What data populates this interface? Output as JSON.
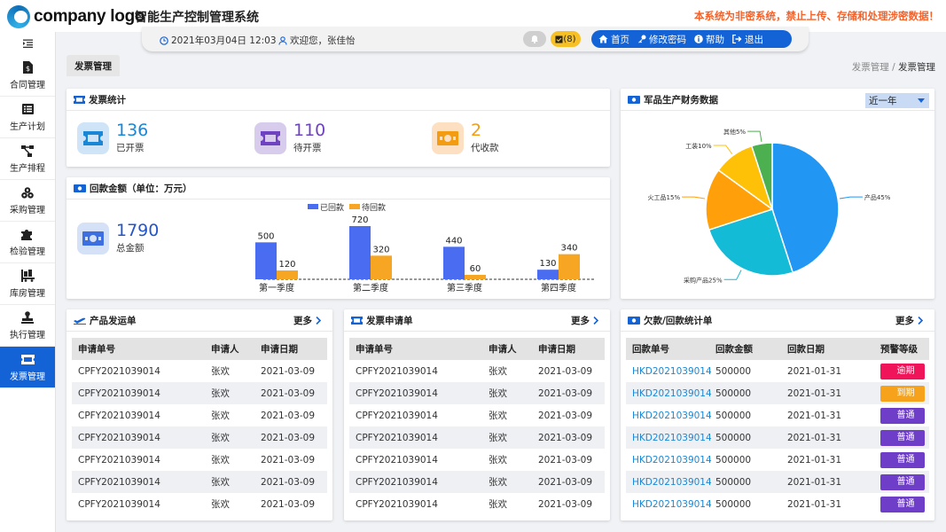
{
  "header": {
    "logo_text": "company logo",
    "system_name": "智能生产控制管理系统",
    "notice": "本系统为非密系统，禁止上传、存储和处理涉密数据！"
  },
  "infobar": {
    "datetime": "2021年03月04日 12:03",
    "welcome": "欢迎您，张佳怡",
    "task_count": "(8)",
    "nav": [
      {
        "label": "首页",
        "icon": "home-icon"
      },
      {
        "label": "修改密码",
        "icon": "key-icon"
      },
      {
        "label": "帮助",
        "icon": "info-icon"
      },
      {
        "label": "退出",
        "icon": "logout-icon"
      }
    ]
  },
  "sidebar": {
    "items": [
      {
        "label": "合同管理",
        "icon": "document-dollar-icon"
      },
      {
        "label": "生产计划",
        "icon": "list-icon"
      },
      {
        "label": "生产排程",
        "icon": "flow-icon"
      },
      {
        "label": "采购管理",
        "icon": "boxes-icon"
      },
      {
        "label": "检验管理",
        "icon": "puzzle-icon"
      },
      {
        "label": "库房管理",
        "icon": "warehouse-icon"
      },
      {
        "label": "执行管理",
        "icon": "stamp-icon"
      },
      {
        "label": "发票管理",
        "icon": "ticket-icon",
        "active": true
      }
    ]
  },
  "page": {
    "tab": "发票管理",
    "breadcrumb_parent": "发票管理",
    "breadcrumb_sep": "/",
    "breadcrumb_current": "发票管理"
  },
  "invoice_stats": {
    "title": "发票统计",
    "items": [
      {
        "value": "136",
        "label": "已开票",
        "color": "#1a87d6"
      },
      {
        "value": "110",
        "label": "待开票",
        "color": "#6f42c1"
      },
      {
        "value": "2",
        "label": "代收款",
        "color": "#f39c12"
      }
    ]
  },
  "collection": {
    "title": "回款金额（单位：万元）",
    "total_value": "1790",
    "total_label": "总金额",
    "colors": {
      "collected": "#4a6cf0",
      "pending": "#f7a623"
    }
  },
  "chart_data": [
    {
      "type": "bar",
      "title": "回款金额（单位：万元）",
      "categories": [
        "第一季度",
        "第二季度",
        "第三季度",
        "第四季度"
      ],
      "series": [
        {
          "name": "已回款",
          "values": [
            500,
            720,
            440,
            130
          ]
        },
        {
          "name": "待回款",
          "values": [
            120,
            320,
            60,
            340
          ]
        }
      ],
      "legend": "top",
      "grid": false
    },
    {
      "type": "pie",
      "title": "军品生产财务数据",
      "slices": [
        {
          "label": "产品45%",
          "value": 45,
          "color": "#2196f3"
        },
        {
          "label": "采购产品25%",
          "value": 25,
          "color": "#13bbd6"
        },
        {
          "label": "火工品15%",
          "value": 15,
          "color": "#ff9f0a"
        },
        {
          "label": "工装10%",
          "value": 10,
          "color": "#ffc107"
        },
        {
          "label": "其他5%",
          "value": 5,
          "color": "#4caf50"
        }
      ]
    }
  ],
  "finance": {
    "title": "军品生产财务数据",
    "period": "近一年"
  },
  "shipping": {
    "title": "产品发运单",
    "more": "更多",
    "columns": [
      "申请单号",
      "申请人",
      "申请日期"
    ],
    "rows": [
      [
        "CPFY2021039014",
        "张欢",
        "2021-03-09"
      ],
      [
        "CPFY2021039014",
        "张欢",
        "2021-03-09"
      ],
      [
        "CPFY2021039014",
        "张欢",
        "2021-03-09"
      ],
      [
        "CPFY2021039014",
        "张欢",
        "2021-03-09"
      ],
      [
        "CPFY2021039014",
        "张欢",
        "2021-03-09"
      ],
      [
        "CPFY2021039014",
        "张欢",
        "2021-03-09"
      ],
      [
        "CPFY2021039014",
        "张欢",
        "2021-03-09"
      ]
    ]
  },
  "invoice_requests": {
    "title": "发票申请单",
    "more": "更多",
    "columns": [
      "申请单号",
      "申请人",
      "申请日期"
    ],
    "rows": [
      [
        "CPFY2021039014",
        "张欢",
        "2021-03-09"
      ],
      [
        "CPFY2021039014",
        "张欢",
        "2021-03-09"
      ],
      [
        "CPFY2021039014",
        "张欢",
        "2021-03-09"
      ],
      [
        "CPFY2021039014",
        "张欢",
        "2021-03-09"
      ],
      [
        "CPFY2021039014",
        "张欢",
        "2021-03-09"
      ],
      [
        "CPFY2021039014",
        "张欢",
        "2021-03-09"
      ],
      [
        "CPFY2021039014",
        "张欢",
        "2021-03-09"
      ]
    ]
  },
  "arrears": {
    "title": "欠款/回款统计单",
    "more": "更多",
    "columns": [
      "回款单号",
      "回款金额",
      "回款日期",
      "预警等级"
    ],
    "rows": [
      [
        "HKD2021039014",
        "500000",
        "2021-01-31",
        "逾期"
      ],
      [
        "HKD2021039014",
        "500000",
        "2021-01-31",
        "到期"
      ],
      [
        "HKD2021039014",
        "500000",
        "2021-01-31",
        "普通"
      ],
      [
        "HKD2021039014",
        "500000",
        "2021-01-31",
        "普通"
      ],
      [
        "HKD2021039014",
        "500000",
        "2021-01-31",
        "普通"
      ],
      [
        "HKD2021039014",
        "500000",
        "2021-01-31",
        "普通"
      ],
      [
        "HKD2021039014",
        "500000",
        "2021-01-31",
        "普通"
      ]
    ],
    "badge_colors": {
      "逾期": "#f0145a",
      "到期": "#f7a21b",
      "普通": "#6f3ec9"
    }
  }
}
